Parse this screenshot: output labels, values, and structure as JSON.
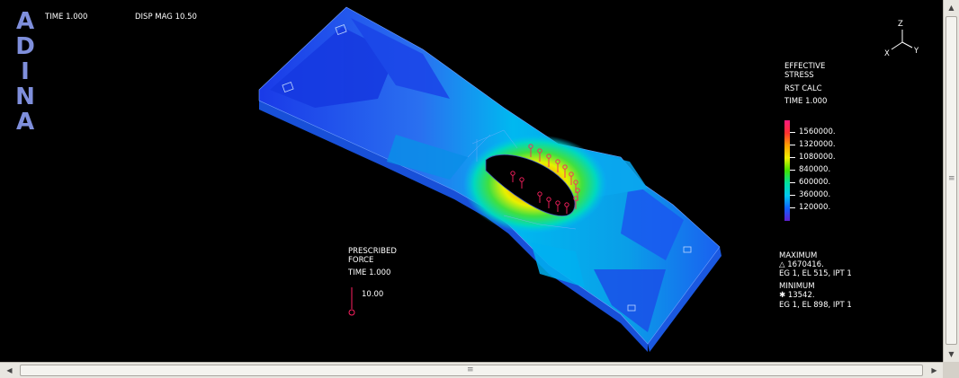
{
  "logo": {
    "letters": [
      "A",
      "D",
      "I",
      "N",
      "A"
    ]
  },
  "header": {
    "time_label": "TIME 1.000",
    "disp_mag_label": "DISP MAG 10.50"
  },
  "triad": {
    "z_label": "Z",
    "x_label": "X",
    "y_label": "Y"
  },
  "stress_legend": {
    "title_line1": "EFFECTIVE",
    "title_line2": "STRESS",
    "subtitle": "RST CALC",
    "time_label": "TIME 1.000",
    "levels": [
      "1560000.",
      "1320000.",
      "1080000.",
      "840000.",
      "600000.",
      "360000.",
      "120000."
    ],
    "colors": [
      "#ff1a80",
      "#ff3030",
      "#ffa000",
      "#f0f000",
      "#40e000",
      "#00e0a0",
      "#00c8f0",
      "#1060ff",
      "#6020d0"
    ]
  },
  "extremes": {
    "maximum_label": "MAXIMUM",
    "maximum_value": "△ 1670416.",
    "maximum_location": "EG 1, EL 515, IPT 1",
    "minimum_label": "MINIMUM",
    "minimum_value": "✱ 13542.",
    "minimum_location": "EG 1, EL 898, IPT 1"
  },
  "force_legend": {
    "title_line1": "PRESCRIBED",
    "title_line2": "FORCE",
    "time_label": "TIME 1.000",
    "value": "10.00"
  },
  "scrollbars": {
    "up_arrow": "▲",
    "down_arrow": "▼",
    "left_arrow": "◀",
    "right_arrow": "▶",
    "grip": "≡"
  }
}
